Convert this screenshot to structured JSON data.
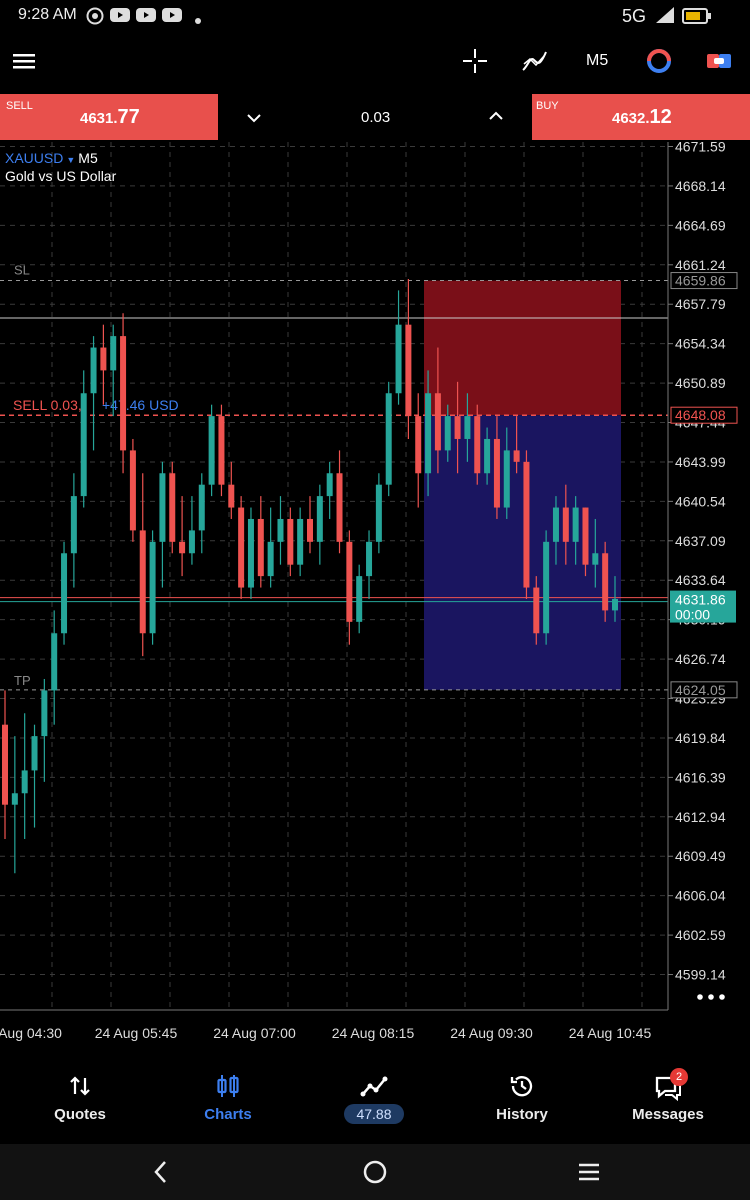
{
  "status": {
    "time": "9:28 AM",
    "network": "5G",
    "icons": [
      "chrome-icon",
      "youtube-icon",
      "youtube-icon",
      "youtube-icon",
      "dot-icon"
    ]
  },
  "toolbar": {
    "timeframe": "M5"
  },
  "trade": {
    "sell": {
      "label": "SELL",
      "price_main": "4631.",
      "price_big": "77"
    },
    "buy": {
      "label": "BUY",
      "price_main": "4632.",
      "price_big": "12"
    },
    "volume": "0.03"
  },
  "chart": {
    "symbol": "XAUUSD",
    "timeframe": "M5",
    "description": "Gold vs US Dollar",
    "sl_label": "SL",
    "tp_label": "TP",
    "position_label": "SELL 0.03,",
    "profit_label": "+47.46 USD",
    "price_ticks": [
      "4671.59",
      "4668.14",
      "4664.69",
      "4661.24",
      "4657.79",
      "4654.34",
      "4650.89",
      "4647.44",
      "4643.99",
      "4640.54",
      "4637.09",
      "4633.64",
      "4630.19",
      "4626.74",
      "4623.29",
      "4619.84",
      "4616.39",
      "4612.94",
      "4609.49",
      "4606.04",
      "4602.59",
      "4599.14"
    ],
    "time_ticks": [
      "Aug 04:30",
      "24 Aug 05:45",
      "24 Aug 07:00",
      "24 Aug 08:15",
      "24 Aug 09:30",
      "24 Aug 10:45"
    ],
    "sl_price": "4659.86",
    "entry_price": "4648.08",
    "tp_price": "4624.05",
    "current_price": "4631.86",
    "countdown": "00:00",
    "colors": {
      "up": "#26a69a",
      "down": "#ef5350",
      "sl_zone": "#7a0f18",
      "tp_zone": "#1a1560",
      "accent": "#3d7ff0"
    }
  },
  "chart_data": {
    "type": "candlestick",
    "symbol": "XAUUSD",
    "ylim": [
      4599.14,
      4671.59
    ],
    "x_ticks": [
      "Aug 04:30",
      "24 Aug 05:45",
      "24 Aug 07:00",
      "24 Aug 08:15",
      "24 Aug 09:30",
      "24 Aug 10:45"
    ],
    "candles": [
      {
        "o": 4621,
        "h": 4624,
        "l": 4611,
        "c": 4614
      },
      {
        "o": 4614,
        "h": 4620,
        "l": 4608,
        "c": 4615
      },
      {
        "o": 4615,
        "h": 4622,
        "l": 4611,
        "c": 4617
      },
      {
        "o": 4617,
        "h": 4621,
        "l": 4612,
        "c": 4620
      },
      {
        "o": 4620,
        "h": 4625,
        "l": 4616,
        "c": 4624
      },
      {
        "o": 4624,
        "h": 4631,
        "l": 4621,
        "c": 4629
      },
      {
        "o": 4629,
        "h": 4637,
        "l": 4628,
        "c": 4636
      },
      {
        "o": 4636,
        "h": 4643,
        "l": 4633,
        "c": 4641
      },
      {
        "o": 4641,
        "h": 4652,
        "l": 4640,
        "c": 4650
      },
      {
        "o": 4650,
        "h": 4655,
        "l": 4645,
        "c": 4654
      },
      {
        "o": 4654,
        "h": 4656,
        "l": 4649,
        "c": 4652
      },
      {
        "o": 4652,
        "h": 4656,
        "l": 4648,
        "c": 4655
      },
      {
        "o": 4655,
        "h": 4657,
        "l": 4643,
        "c": 4645
      },
      {
        "o": 4645,
        "h": 4646,
        "l": 4637,
        "c": 4638
      },
      {
        "o": 4638,
        "h": 4643,
        "l": 4627,
        "c": 4629
      },
      {
        "o": 4629,
        "h": 4638,
        "l": 4628,
        "c": 4637
      },
      {
        "o": 4637,
        "h": 4644,
        "l": 4633,
        "c": 4643
      },
      {
        "o": 4643,
        "h": 4644,
        "l": 4636,
        "c": 4637
      },
      {
        "o": 4637,
        "h": 4641,
        "l": 4634,
        "c": 4636
      },
      {
        "o": 4636,
        "h": 4641,
        "l": 4635,
        "c": 4638
      },
      {
        "o": 4638,
        "h": 4643,
        "l": 4636,
        "c": 4642
      },
      {
        "o": 4642,
        "h": 4649,
        "l": 4641,
        "c": 4648
      },
      {
        "o": 4648,
        "h": 4649,
        "l": 4641,
        "c": 4642
      },
      {
        "o": 4642,
        "h": 4644,
        "l": 4639,
        "c": 4640
      },
      {
        "o": 4640,
        "h": 4641,
        "l": 4632,
        "c": 4633
      },
      {
        "o": 4633,
        "h": 4640,
        "l": 4632,
        "c": 4639
      },
      {
        "o": 4639,
        "h": 4641,
        "l": 4633,
        "c": 4634
      },
      {
        "o": 4634,
        "h": 4640,
        "l": 4633,
        "c": 4637
      },
      {
        "o": 4637,
        "h": 4641,
        "l": 4635,
        "c": 4639
      },
      {
        "o": 4639,
        "h": 4640,
        "l": 4634,
        "c": 4635
      },
      {
        "o": 4635,
        "h": 4640,
        "l": 4634,
        "c": 4639
      },
      {
        "o": 4639,
        "h": 4641,
        "l": 4636,
        "c": 4637
      },
      {
        "o": 4637,
        "h": 4642,
        "l": 4635,
        "c": 4641
      },
      {
        "o": 4641,
        "h": 4644,
        "l": 4639,
        "c": 4643
      },
      {
        "o": 4643,
        "h": 4645,
        "l": 4636,
        "c": 4637
      },
      {
        "o": 4637,
        "h": 4638,
        "l": 4628,
        "c": 4630
      },
      {
        "o": 4630,
        "h": 4635,
        "l": 4629,
        "c": 4634
      },
      {
        "o": 4634,
        "h": 4638,
        "l": 4632,
        "c": 4637
      },
      {
        "o": 4637,
        "h": 4643,
        "l": 4636,
        "c": 4642
      },
      {
        "o": 4642,
        "h": 4651,
        "l": 4641,
        "c": 4650
      },
      {
        "o": 4650,
        "h": 4659,
        "l": 4649,
        "c": 4656
      },
      {
        "o": 4656,
        "h": 4660,
        "l": 4646,
        "c": 4648
      },
      {
        "o": 4648,
        "h": 4650,
        "l": 4640,
        "c": 4643
      },
      {
        "o": 4643,
        "h": 4652,
        "l": 4641,
        "c": 4650
      },
      {
        "o": 4650,
        "h": 4654,
        "l": 4643,
        "c": 4645
      },
      {
        "o": 4645,
        "h": 4649,
        "l": 4644,
        "c": 4648
      },
      {
        "o": 4648,
        "h": 4651,
        "l": 4643,
        "c": 4646
      },
      {
        "o": 4646,
        "h": 4650,
        "l": 4644,
        "c": 4648
      },
      {
        "o": 4648,
        "h": 4649,
        "l": 4642,
        "c": 4643
      },
      {
        "o": 4643,
        "h": 4647,
        "l": 4642,
        "c": 4646
      },
      {
        "o": 4646,
        "h": 4648,
        "l": 4639,
        "c": 4640
      },
      {
        "o": 4640,
        "h": 4647,
        "l": 4639,
        "c": 4645
      },
      {
        "o": 4645,
        "h": 4648,
        "l": 4643,
        "c": 4644
      },
      {
        "o": 4644,
        "h": 4645,
        "l": 4632,
        "c": 4633
      },
      {
        "o": 4633,
        "h": 4634,
        "l": 4628,
        "c": 4629
      },
      {
        "o": 4629,
        "h": 4638,
        "l": 4628,
        "c": 4637
      },
      {
        "o": 4637,
        "h": 4641,
        "l": 4635,
        "c": 4640
      },
      {
        "o": 4640,
        "h": 4642,
        "l": 4635,
        "c": 4637
      },
      {
        "o": 4637,
        "h": 4641,
        "l": 4635,
        "c": 4640
      },
      {
        "o": 4640,
        "h": 4640,
        "l": 4634,
        "c": 4635
      },
      {
        "o": 4635,
        "h": 4639,
        "l": 4633,
        "c": 4636
      },
      {
        "o": 4636,
        "h": 4637,
        "l": 4630,
        "c": 4631
      },
      {
        "o": 4631,
        "h": 4634,
        "l": 4630,
        "c": 4632
      }
    ],
    "levels": {
      "sl": 4659.86,
      "entry": 4648.08,
      "tp": 4624.05,
      "current": 4631.86
    }
  },
  "nav": {
    "items": [
      {
        "label": "Quotes"
      },
      {
        "label": "Charts"
      },
      {
        "label": "47.88"
      },
      {
        "label": "History"
      },
      {
        "label": "Messages",
        "badge": "2"
      }
    ]
  }
}
